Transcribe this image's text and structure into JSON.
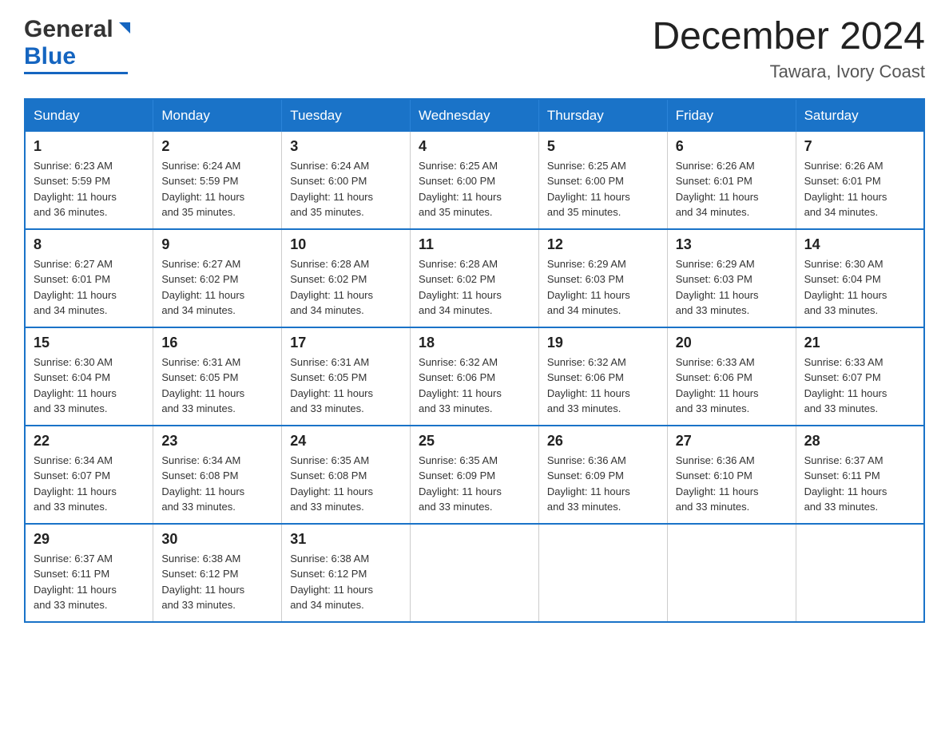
{
  "header": {
    "logo_general": "General",
    "logo_blue": "Blue",
    "month_title": "December 2024",
    "location": "Tawara, Ivory Coast"
  },
  "days_of_week": [
    "Sunday",
    "Monday",
    "Tuesday",
    "Wednesday",
    "Thursday",
    "Friday",
    "Saturday"
  ],
  "weeks": [
    [
      {
        "day": "1",
        "sunrise": "6:23 AM",
        "sunset": "5:59 PM",
        "daylight": "11 hours and 36 minutes."
      },
      {
        "day": "2",
        "sunrise": "6:24 AM",
        "sunset": "5:59 PM",
        "daylight": "11 hours and 35 minutes."
      },
      {
        "day": "3",
        "sunrise": "6:24 AM",
        "sunset": "6:00 PM",
        "daylight": "11 hours and 35 minutes."
      },
      {
        "day": "4",
        "sunrise": "6:25 AM",
        "sunset": "6:00 PM",
        "daylight": "11 hours and 35 minutes."
      },
      {
        "day": "5",
        "sunrise": "6:25 AM",
        "sunset": "6:00 PM",
        "daylight": "11 hours and 35 minutes."
      },
      {
        "day": "6",
        "sunrise": "6:26 AM",
        "sunset": "6:01 PM",
        "daylight": "11 hours and 34 minutes."
      },
      {
        "day": "7",
        "sunrise": "6:26 AM",
        "sunset": "6:01 PM",
        "daylight": "11 hours and 34 minutes."
      }
    ],
    [
      {
        "day": "8",
        "sunrise": "6:27 AM",
        "sunset": "6:01 PM",
        "daylight": "11 hours and 34 minutes."
      },
      {
        "day": "9",
        "sunrise": "6:27 AM",
        "sunset": "6:02 PM",
        "daylight": "11 hours and 34 minutes."
      },
      {
        "day": "10",
        "sunrise": "6:28 AM",
        "sunset": "6:02 PM",
        "daylight": "11 hours and 34 minutes."
      },
      {
        "day": "11",
        "sunrise": "6:28 AM",
        "sunset": "6:02 PM",
        "daylight": "11 hours and 34 minutes."
      },
      {
        "day": "12",
        "sunrise": "6:29 AM",
        "sunset": "6:03 PM",
        "daylight": "11 hours and 34 minutes."
      },
      {
        "day": "13",
        "sunrise": "6:29 AM",
        "sunset": "6:03 PM",
        "daylight": "11 hours and 33 minutes."
      },
      {
        "day": "14",
        "sunrise": "6:30 AM",
        "sunset": "6:04 PM",
        "daylight": "11 hours and 33 minutes."
      }
    ],
    [
      {
        "day": "15",
        "sunrise": "6:30 AM",
        "sunset": "6:04 PM",
        "daylight": "11 hours and 33 minutes."
      },
      {
        "day": "16",
        "sunrise": "6:31 AM",
        "sunset": "6:05 PM",
        "daylight": "11 hours and 33 minutes."
      },
      {
        "day": "17",
        "sunrise": "6:31 AM",
        "sunset": "6:05 PM",
        "daylight": "11 hours and 33 minutes."
      },
      {
        "day": "18",
        "sunrise": "6:32 AM",
        "sunset": "6:06 PM",
        "daylight": "11 hours and 33 minutes."
      },
      {
        "day": "19",
        "sunrise": "6:32 AM",
        "sunset": "6:06 PM",
        "daylight": "11 hours and 33 minutes."
      },
      {
        "day": "20",
        "sunrise": "6:33 AM",
        "sunset": "6:06 PM",
        "daylight": "11 hours and 33 minutes."
      },
      {
        "day": "21",
        "sunrise": "6:33 AM",
        "sunset": "6:07 PM",
        "daylight": "11 hours and 33 minutes."
      }
    ],
    [
      {
        "day": "22",
        "sunrise": "6:34 AM",
        "sunset": "6:07 PM",
        "daylight": "11 hours and 33 minutes."
      },
      {
        "day": "23",
        "sunrise": "6:34 AM",
        "sunset": "6:08 PM",
        "daylight": "11 hours and 33 minutes."
      },
      {
        "day": "24",
        "sunrise": "6:35 AM",
        "sunset": "6:08 PM",
        "daylight": "11 hours and 33 minutes."
      },
      {
        "day": "25",
        "sunrise": "6:35 AM",
        "sunset": "6:09 PM",
        "daylight": "11 hours and 33 minutes."
      },
      {
        "day": "26",
        "sunrise": "6:36 AM",
        "sunset": "6:09 PM",
        "daylight": "11 hours and 33 minutes."
      },
      {
        "day": "27",
        "sunrise": "6:36 AM",
        "sunset": "6:10 PM",
        "daylight": "11 hours and 33 minutes."
      },
      {
        "day": "28",
        "sunrise": "6:37 AM",
        "sunset": "6:11 PM",
        "daylight": "11 hours and 33 minutes."
      }
    ],
    [
      {
        "day": "29",
        "sunrise": "6:37 AM",
        "sunset": "6:11 PM",
        "daylight": "11 hours and 33 minutes."
      },
      {
        "day": "30",
        "sunrise": "6:38 AM",
        "sunset": "6:12 PM",
        "daylight": "11 hours and 33 minutes."
      },
      {
        "day": "31",
        "sunrise": "6:38 AM",
        "sunset": "6:12 PM",
        "daylight": "11 hours and 34 minutes."
      },
      null,
      null,
      null,
      null
    ]
  ],
  "labels": {
    "sunrise": "Sunrise:",
    "sunset": "Sunset:",
    "daylight": "Daylight:"
  }
}
